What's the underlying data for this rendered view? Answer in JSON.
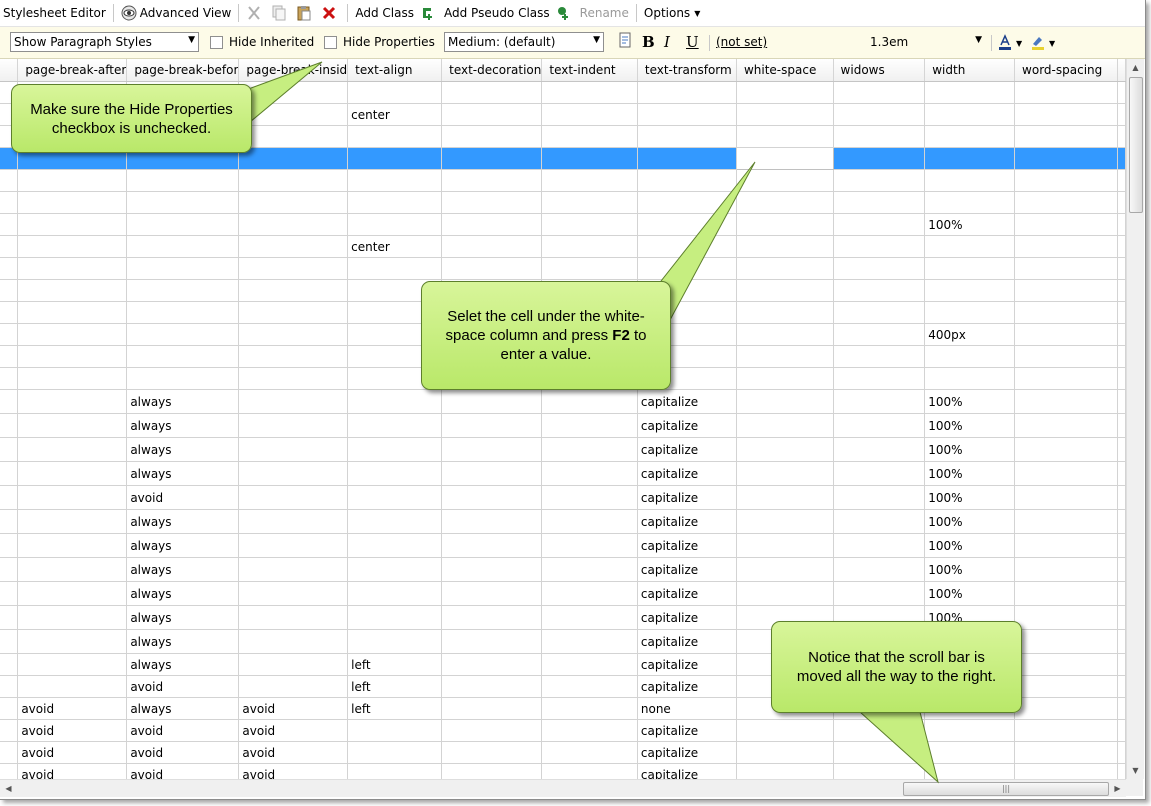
{
  "toolbar": {
    "title": "Stylesheet Editor",
    "advanced_view": "Advanced View",
    "add_class": "Add Class",
    "add_pseudo_class": "Add Pseudo Class",
    "rename": "Rename",
    "options": "Options"
  },
  "formatbar": {
    "style_filter": "Show Paragraph Styles",
    "hide_inherited": "Hide Inherited",
    "hide_properties": "Hide Properties",
    "medium": "Medium: (default)",
    "bold": "B",
    "italic": "I",
    "underline": "U",
    "not_set": "(not set)",
    "size": "1.3em"
  },
  "grid": {
    "columns": [
      "page-break-after",
      "page-break-befor",
      "page-break-insid",
      "text-align",
      "text-decoration",
      "text-indent",
      "text-transform",
      "white-space",
      "widows",
      "width",
      "word-spacing"
    ],
    "rows": [
      [
        "",
        "",
        "",
        "",
        "",
        "",
        "",
        "",
        "",
        "",
        ""
      ],
      [
        "",
        "",
        "",
        "center",
        "",
        "",
        "",
        "",
        "",
        "",
        ""
      ],
      [
        "",
        "",
        "",
        "",
        "",
        "",
        "",
        "",
        "",
        "",
        ""
      ],
      [
        "",
        "",
        "",
        "",
        "",
        "",
        "",
        "",
        "",
        "",
        ""
      ],
      [
        "",
        "",
        "",
        "",
        "",
        "",
        "",
        "",
        "",
        "",
        ""
      ],
      [
        "",
        "",
        "",
        "",
        "",
        "",
        "",
        "",
        "",
        "",
        ""
      ],
      [
        "",
        "",
        "",
        "",
        "",
        "",
        "",
        "",
        "",
        "100%",
        ""
      ],
      [
        "",
        "",
        "",
        "center",
        "",
        "",
        "",
        "",
        "",
        "",
        ""
      ],
      [
        "",
        "",
        "",
        "",
        "",
        "",
        "",
        "",
        "",
        "",
        ""
      ],
      [
        "",
        "",
        "",
        "",
        "",
        "",
        "",
        "",
        "",
        "",
        ""
      ],
      [
        "",
        "",
        "",
        "",
        "",
        "",
        "",
        "",
        "",
        "",
        ""
      ],
      [
        "",
        "",
        "",
        "",
        "",
        "",
        "",
        "",
        "",
        "400px",
        ""
      ],
      [
        "",
        "",
        "",
        "",
        "",
        "",
        "",
        "",
        "",
        "",
        ""
      ],
      [
        "",
        "",
        "",
        "",
        "",
        "",
        "",
        "",
        "",
        "",
        ""
      ],
      [
        "",
        "always",
        "",
        "",
        "",
        "",
        "capitalize",
        "",
        "",
        "100%",
        ""
      ],
      [
        "",
        "always",
        "",
        "",
        "",
        "",
        "capitalize",
        "",
        "",
        "100%",
        ""
      ],
      [
        "",
        "always",
        "",
        "",
        "",
        "",
        "capitalize",
        "",
        "",
        "100%",
        ""
      ],
      [
        "",
        "always",
        "",
        "",
        "",
        "",
        "capitalize",
        "",
        "",
        "100%",
        ""
      ],
      [
        "",
        "avoid",
        "",
        "",
        "",
        "",
        "capitalize",
        "",
        "",
        "100%",
        ""
      ],
      [
        "",
        "always",
        "",
        "",
        "",
        "",
        "capitalize",
        "",
        "",
        "100%",
        ""
      ],
      [
        "",
        "always",
        "",
        "",
        "",
        "",
        "capitalize",
        "",
        "",
        "100%",
        ""
      ],
      [
        "",
        "always",
        "",
        "",
        "",
        "",
        "capitalize",
        "",
        "",
        "100%",
        ""
      ],
      [
        "",
        "always",
        "",
        "",
        "",
        "",
        "capitalize",
        "",
        "",
        "100%",
        ""
      ],
      [
        "",
        "always",
        "",
        "",
        "",
        "",
        "capitalize",
        "",
        "",
        "100%",
        ""
      ],
      [
        "",
        "always",
        "",
        "",
        "",
        "",
        "capitalize",
        "",
        "",
        "",
        ""
      ],
      [
        "",
        "always",
        "",
        "left",
        "",
        "",
        "capitalize",
        "",
        "",
        "",
        ""
      ],
      [
        "",
        "avoid",
        "",
        "left",
        "",
        "",
        "capitalize",
        "",
        "",
        "",
        ""
      ],
      [
        "avoid",
        "always",
        "avoid",
        "left",
        "",
        "",
        "none",
        "",
        "",
        "",
        ""
      ],
      [
        "avoid",
        "avoid",
        "avoid",
        "",
        "",
        "",
        "capitalize",
        "",
        "",
        "",
        ""
      ],
      [
        "avoid",
        "avoid",
        "avoid",
        "",
        "",
        "",
        "capitalize",
        "",
        "",
        "",
        ""
      ],
      [
        "avoid",
        "avoid",
        "avoid",
        "",
        "",
        "",
        "capitalize",
        "",
        "",
        "",
        ""
      ]
    ],
    "selected_row": 3,
    "current_column": 7
  },
  "callouts": {
    "hide_properties_note": "Make sure the Hide Properties checkbox is unchecked.",
    "f2_note_pre": "Selet the cell under the white-space column and press",
    "f2_key": "F2",
    "f2_note_post": "to enter a value.",
    "scroll_note": "Notice that the scroll bar is moved all the way to the right."
  },
  "colors": {
    "selection": "#3399ff",
    "callout_fill": "#c6ee80",
    "delete_icon": "#cc1111",
    "toolbar_band": "#fdfbe8"
  },
  "icons": [
    "eye-icon",
    "cut-icon",
    "copy-icon",
    "paste-icon",
    "delete-icon",
    "add-class-icon",
    "add-pseudo-class-icon",
    "rename-icon",
    "paragraph-icon",
    "font-color-icon",
    "highlight-icon"
  ]
}
